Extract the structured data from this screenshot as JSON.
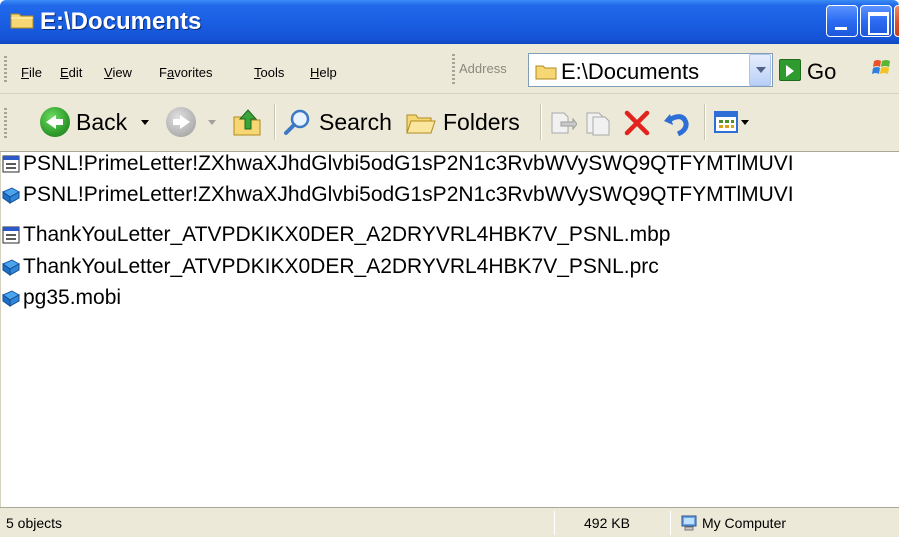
{
  "window": {
    "title": "E:\\Documents"
  },
  "menu": {
    "items": [
      {
        "label": "File",
        "underline": "F",
        "rest": "ile"
      },
      {
        "label": "Edit",
        "underline": "E",
        "rest": "dit"
      },
      {
        "label": "View",
        "underline": "V",
        "rest": "iew"
      },
      {
        "label": "Favorites",
        "underline": "a",
        "prefix": "F",
        "rest": "vorites"
      },
      {
        "label": "Tools",
        "underline": "T",
        "rest": "ools"
      },
      {
        "label": "Help",
        "underline": "H",
        "rest": "elp"
      }
    ]
  },
  "address": {
    "label": "Address",
    "value": "E:\\Documents",
    "go_label": "Go"
  },
  "toolbar": {
    "back_label": "Back",
    "search_label": "Search",
    "folders_label": "Folders"
  },
  "files": [
    {
      "name": "PSNL!PrimeLetter!ZXhwaXJhdGlvbi5odG1sP2N1c3RvbWVySWQ9QTFYMTlMUVI",
      "icon": "mbp-file-icon"
    },
    {
      "name": "PSNL!PrimeLetter!ZXhwaXJhdGlvbi5odG1sP2N1c3RvbWVySWQ9QTFYMTlMUVI",
      "icon": "ebook-icon"
    },
    {
      "name": "ThankYouLetter_ATVPDKIKX0DER_A2DRYVRL4HBK7V_PSNL.mbp",
      "icon": "mbp-file-icon"
    },
    {
      "name": "ThankYouLetter_ATVPDKIKX0DER_A2DRYVRL4HBK7V_PSNL.prc",
      "icon": "ebook-icon"
    },
    {
      "name": "pg35.mobi",
      "icon": "ebook-icon"
    }
  ],
  "status": {
    "objects": "5 objects",
    "size": "492 KB",
    "location": "My Computer"
  },
  "colors": {
    "titlebar": "#1a5fe3",
    "chrome": "#ece9d8",
    "ebook_icon": "#1e6fc6"
  }
}
